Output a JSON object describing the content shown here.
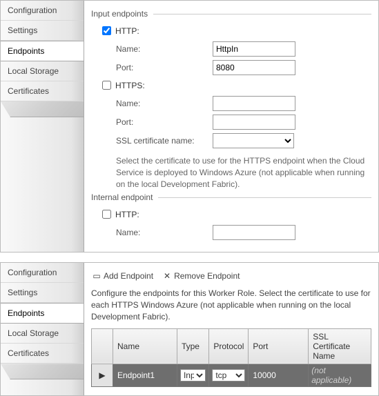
{
  "panel1": {
    "sidebar": {
      "items": [
        "Configuration",
        "Settings",
        "Endpoints",
        "Local Storage",
        "Certificates"
      ],
      "active": 2
    },
    "inputEndpoints": {
      "header": "Input endpoints",
      "http": {
        "label": "HTTP:",
        "checked": true,
        "nameLabel": "Name:",
        "nameValue": "HttpIn",
        "portLabel": "Port:",
        "portValue": "8080"
      },
      "https": {
        "label": "HTTPS:",
        "checked": false,
        "nameLabel": "Name:",
        "nameValue": "",
        "portLabel": "Port:",
        "portValue": "",
        "sslLabel": "SSL certificate name:",
        "sslValue": ""
      },
      "help": "Select the certificate to use for the HTTPS endpoint when the Cloud Service is deployed to Windows Azure (not applicable when running on the local Development Fabric)."
    },
    "internalEndpoint": {
      "header": "Internal endpoint",
      "http": {
        "label": "HTTP:",
        "checked": false,
        "nameLabel": "Name:",
        "nameValue": ""
      }
    }
  },
  "panel2": {
    "sidebar": {
      "items": [
        "Configuration",
        "Settings",
        "Endpoints",
        "Local Storage",
        "Certificates"
      ],
      "active": 2
    },
    "toolbar": {
      "addLabel": "Add Endpoint",
      "removeLabel": "Remove Endpoint"
    },
    "description": "Configure the endpoints for this Worker Role.  Select the certificate to use for each HTTPS Windows Azure (not applicable when running on the local Development Fabric).",
    "grid": {
      "headers": [
        "",
        "Name",
        "Type",
        "Protocol",
        "Port",
        "SSL Certificate Name"
      ],
      "rows": [
        {
          "marker": "▶",
          "name": "Endpoint1",
          "type": "Input",
          "protocol": "tcp",
          "port": "10000",
          "ssl": "(not applicable)"
        }
      ]
    }
  }
}
